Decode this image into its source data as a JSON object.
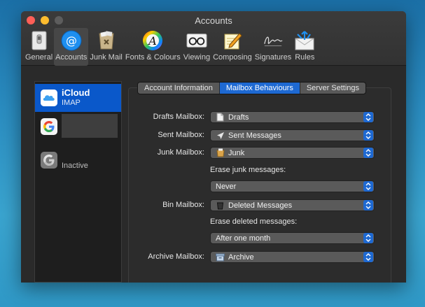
{
  "window": {
    "title": "Accounts"
  },
  "toolbar": {
    "items": [
      {
        "label": "General",
        "icon": "general-switch-icon"
      },
      {
        "label": "Accounts",
        "icon": "at-sign-icon",
        "active": true
      },
      {
        "label": "Junk Mail",
        "icon": "junk-bin-icon"
      },
      {
        "label": "Fonts & Colours",
        "icon": "font-colour-wheel-icon"
      },
      {
        "label": "Viewing",
        "icon": "glasses-icon"
      },
      {
        "label": "Composing",
        "icon": "pencil-notepad-icon"
      },
      {
        "label": "Signatures",
        "icon": "signature-icon"
      },
      {
        "label": "Rules",
        "icon": "envelope-arrows-icon"
      }
    ]
  },
  "accounts": [
    {
      "name": "iCloud",
      "type": "IMAP",
      "icon": "icloud-icon",
      "selected": true
    },
    {
      "name": "",
      "icon": "google-icon"
    },
    {
      "status": "Inactive",
      "icon": "google-icon"
    }
  ],
  "tabs": [
    {
      "label": "Account Information"
    },
    {
      "label": "Mailbox Behaviours",
      "active": true
    },
    {
      "label": "Server Settings"
    }
  ],
  "form": {
    "drafts": {
      "label": "Drafts Mailbox:",
      "value": "Drafts",
      "icon": "document-icon"
    },
    "sent": {
      "label": "Sent Mailbox:",
      "value": "Sent Messages",
      "icon": "paper-plane-icon"
    },
    "junk": {
      "label": "Junk Mailbox:",
      "value": "Junk",
      "icon": "junk-bin-icon"
    },
    "erase_junk": {
      "label": "Erase junk messages:",
      "value": "Never"
    },
    "bin": {
      "label": "Bin Mailbox:",
      "value": "Deleted Messages",
      "icon": "trash-can-icon"
    },
    "erase_deleted": {
      "label": "Erase deleted messages:",
      "value": "After one month"
    },
    "archive": {
      "label": "Archive Mailbox:",
      "value": "Archive",
      "icon": "archive-box-icon"
    }
  },
  "colors": {
    "accent": "#1e69d2",
    "selection": "#0a58ca",
    "window": "#2a2a2a"
  }
}
